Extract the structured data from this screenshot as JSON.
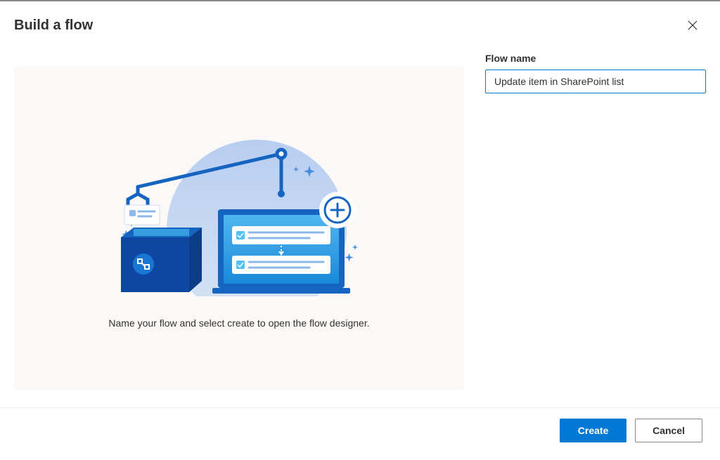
{
  "header": {
    "title": "Build a flow"
  },
  "panel": {
    "instruction": "Name your flow and select create to open the flow designer."
  },
  "form": {
    "flowNameLabel": "Flow name",
    "flowNameValue": "Update item in SharePoint list"
  },
  "footer": {
    "createLabel": "Create",
    "cancelLabel": "Cancel"
  }
}
